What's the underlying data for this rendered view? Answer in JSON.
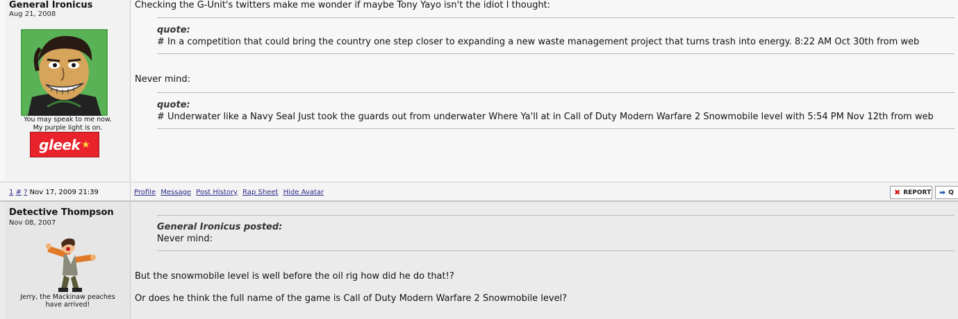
{
  "post1": {
    "username": "General Ironicus",
    "join_date": "Aug 21, 2008",
    "avatar_caption_1": "You may speak to me now.",
    "avatar_caption_2": "My purple light is on.",
    "badge_text": "gleek",
    "intro": "Checking the G-Unit's twitters make me wonder if maybe Tony Yayo isn't the idiot I thought:",
    "quote1_label": "quote:",
    "quote1_text": "# In a competition that could bring the country one step closer to expanding a new waste management project that turns trash into energy. 8:22 AM Oct 30th from web",
    "middle": "Never mind:",
    "quote2_label": "quote:",
    "quote2_text": "# Underwater like a Navy Seal Just took the guards out from underwater Where Ya'll at in Call of Duty Modern Warfare 2 Snowmobile level with 5:54 PM Nov 12th from web"
  },
  "footer": {
    "post_num": "1",
    "hash": "#",
    "qmark": "?",
    "timestamp": "Nov 17, 2009 21:39",
    "links": [
      "Profile",
      "Message",
      "Post History",
      "Rap Sheet",
      "Hide Avatar"
    ],
    "report_label": "REPORT",
    "quote_label": "Q"
  },
  "post2": {
    "username": "Detective Thompson",
    "join_date": "Nov 08, 2007",
    "avatar_caption_1": "Jerry, the Mackinaw peaches",
    "avatar_caption_2": "have arrived!",
    "quote_label": "General Ironicus posted:",
    "quote_text": "Never mind:",
    "line1": "But the snowmobile level is well before the oil rig how did he do that!?",
    "line2": "Or does he think the full name of the game is Call of Duty Modern Warfare 2 Snowmobile level?"
  },
  "colors": {
    "link": "#2a2a8a",
    "report_icon": "#cc1111",
    "badge_bg": "#e8232c"
  }
}
